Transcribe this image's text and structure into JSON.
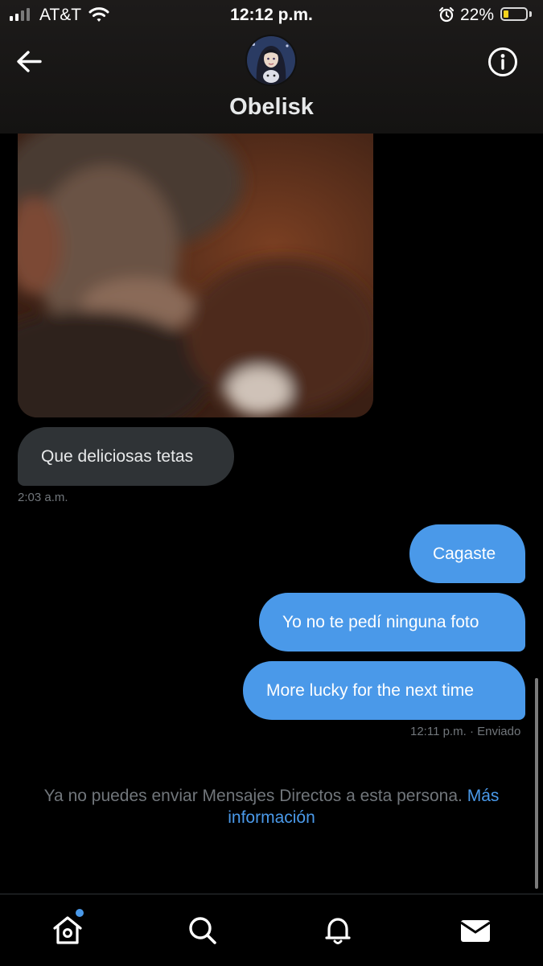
{
  "status_bar": {
    "carrier": "AT&T",
    "time": "12:12 p.m.",
    "battery_percent": "22%",
    "battery_level": 0.22,
    "alarm_icon": "alarm-clock-icon",
    "wifi_icon": "wifi-icon"
  },
  "header": {
    "contact_name": "Obelisk",
    "back_icon": "arrow-left-icon",
    "info_icon": "info-icon"
  },
  "conversation": {
    "received": [
      {
        "text": "Que deliciosas tetas",
        "timestamp": "2:03 a.m."
      }
    ],
    "sent": [
      {
        "text": "Cagaste"
      },
      {
        "text": "Yo no te pedí ninguna foto"
      },
      {
        "text": "More lucky for the next time"
      }
    ],
    "sent_timestamp": "12:11 p.m.",
    "sent_status": "· Enviado"
  },
  "notice": {
    "text": "Ya no puedes enviar Mensajes Directos a esta persona.",
    "link": "Más información"
  },
  "tab_bar": {
    "tabs": [
      {
        "icon": "home-icon",
        "has_notification_dot": true
      },
      {
        "icon": "search-icon"
      },
      {
        "icon": "bell-icon"
      },
      {
        "icon": "mail-icon"
      }
    ]
  },
  "colors": {
    "accent": "#4a99e9",
    "received_bubble": "#2f3336",
    "background": "#000000",
    "muted_text": "#71767b"
  }
}
